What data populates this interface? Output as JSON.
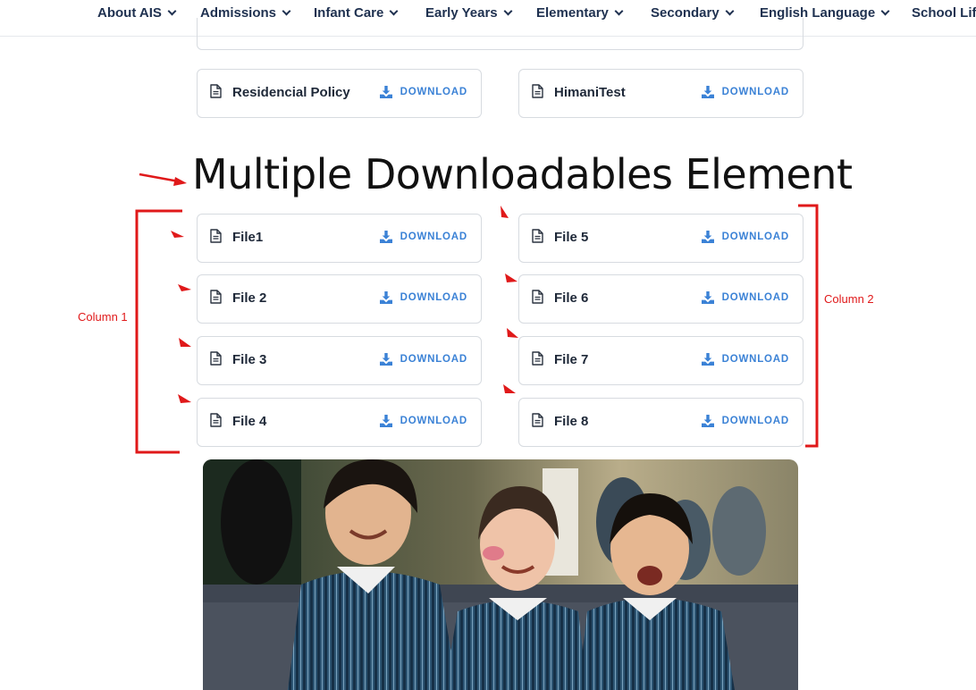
{
  "nav": {
    "items": [
      {
        "label": "About AIS"
      },
      {
        "label": "Admissions"
      },
      {
        "label": "Infant Care"
      },
      {
        "label": "Early Years"
      },
      {
        "label": "Elementary"
      },
      {
        "label": "Secondary"
      },
      {
        "label": "English Language"
      },
      {
        "label": "School Life"
      }
    ]
  },
  "top_downloads": [
    {
      "name": "Residencial Policy",
      "action": "DOWNLOAD"
    },
    {
      "name": "HimaniTest",
      "action": "DOWNLOAD"
    }
  ],
  "section": {
    "title": "Multiple Downloadables Element"
  },
  "column1": {
    "label": "Column 1",
    "files": [
      {
        "name": "File1",
        "action": "DOWNLOAD"
      },
      {
        "name": "File 2",
        "action": "DOWNLOAD"
      },
      {
        "name": "File 3",
        "action": "DOWNLOAD"
      },
      {
        "name": "File 4",
        "action": "DOWNLOAD"
      }
    ]
  },
  "column2": {
    "label": "Column 2",
    "files": [
      {
        "name": "File 5",
        "action": "DOWNLOAD"
      },
      {
        "name": "File 6",
        "action": "DOWNLOAD"
      },
      {
        "name": "File 7",
        "action": "DOWNLOAD"
      },
      {
        "name": "File 8",
        "action": "DOWNLOAD"
      }
    ]
  },
  "icons": {
    "file": "file-text-icon",
    "download": "download-icon",
    "nav_chevron": "chevron-down-icon"
  },
  "colors": {
    "nav_text": "#1f3150",
    "link_blue": "#3b82d6",
    "card_border": "#d7dbe0",
    "annotation_red": "#e0191a"
  }
}
